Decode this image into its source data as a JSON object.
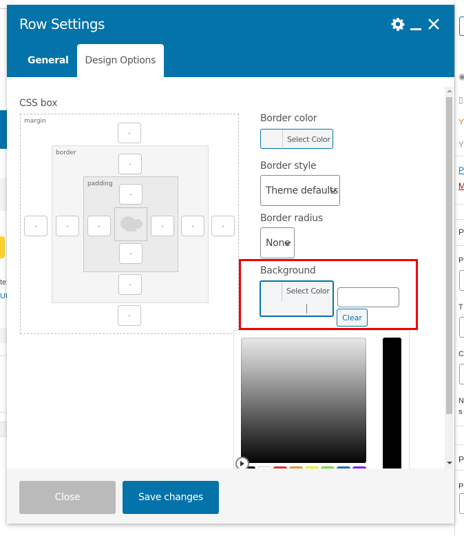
{
  "modal": {
    "title": "Row Settings",
    "header_icons": [
      "gear-icon",
      "minimize-icon",
      "close-icon"
    ],
    "tabs": [
      {
        "label": "General",
        "active": false
      },
      {
        "label": "Design Options",
        "active": true
      }
    ]
  },
  "css_box": {
    "title": "CSS box",
    "labels": {
      "margin": "margin",
      "border": "border",
      "padding": "padding"
    },
    "margin": {
      "top": "-",
      "right": "-",
      "bottom": "-",
      "left": "-"
    },
    "border": {
      "top": "-",
      "right": "-",
      "bottom": "-",
      "left": "-"
    },
    "padding": {
      "top": "-",
      "right": "-",
      "bottom": "-",
      "left": "-"
    },
    "content_icon": "cloud-icon"
  },
  "options": {
    "border_color": {
      "label": "Border color",
      "button": "Select Color"
    },
    "border_style": {
      "label": "Border style",
      "value": "Theme defaults"
    },
    "border_radius": {
      "label": "Border radius",
      "value": "None"
    },
    "background": {
      "label": "Background",
      "button": "Select Color",
      "hex_value": "",
      "clear": "Clear"
    }
  },
  "color_picker": {
    "palette": [
      "#000000",
      "#ffffff",
      "#dd3333",
      "#dd9933",
      "#eeee22",
      "#81d742",
      "#1e73be",
      "#8224e3"
    ],
    "accent": "#0473aa"
  },
  "footer": {
    "close_label": "Close",
    "save_label": "Save changes"
  },
  "background_page": {
    "left_text": [
      "te",
      "Ut"
    ],
    "right_letters": [
      "P",
      "M",
      "P",
      "P",
      "T",
      "C",
      "N",
      "s",
      "P",
      "P"
    ]
  }
}
